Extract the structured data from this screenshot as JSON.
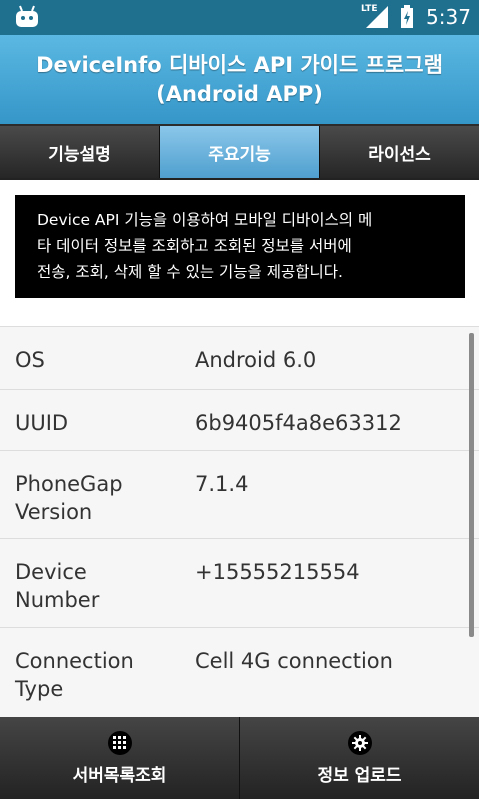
{
  "status_bar": {
    "network": "LTE",
    "time": "5:37"
  },
  "header": {
    "title_line1": "DeviceInfo 디바이스 API 가이드 프로그램",
    "title_line2": "(Android APP)"
  },
  "tabs": [
    {
      "label": "기능설명",
      "active": false
    },
    {
      "label": "주요기능",
      "active": true
    },
    {
      "label": "라이선스",
      "active": false
    }
  ],
  "description": {
    "line1": "Device API 기능을 이용하여 모바일 디바이스의 메",
    "line2": "타 데이터 정보를 조회하고 조회된 정보를 서버에",
    "line3": "전송, 조회, 삭제 할 수 있는 기능을 제공합니다."
  },
  "info_rows": [
    {
      "key_line1": "OS",
      "key_line2": "",
      "value": "Android 6.0"
    },
    {
      "key_line1": "UUID",
      "key_line2": "",
      "value": "6b9405f4a8e63312"
    },
    {
      "key_line1": "PhoneGap",
      "key_line2": "Version",
      "value": "7.1.4"
    },
    {
      "key_line1": "Device",
      "key_line2": "Number",
      "value": "+15555215554"
    },
    {
      "key_line1": "Connection",
      "key_line2": "Type",
      "value": "Cell 4G connection"
    }
  ],
  "bottom_bar": {
    "left": {
      "label": "서버목록조회",
      "icon": "grid-icon"
    },
    "right": {
      "label": "정보 업로드",
      "icon": "gear-icon"
    }
  },
  "colors": {
    "header_blue": "#3596c8",
    "active_tab": "#4f9fcf",
    "status_bar": "#1f6f8f"
  }
}
